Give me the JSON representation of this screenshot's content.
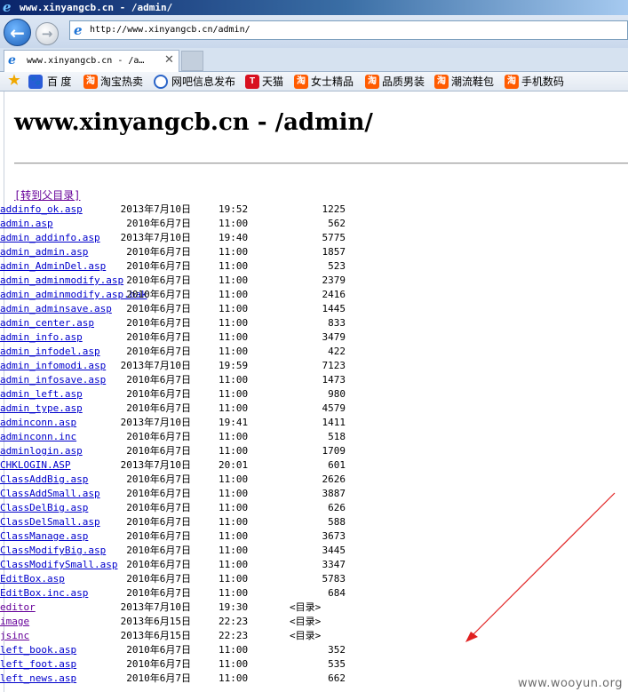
{
  "window": {
    "title": "www.xinyangcb.cn - /admin/"
  },
  "navigation": {
    "address": "http://www.xinyangcb.cn/admin/"
  },
  "tab": {
    "title": "www.xinyangcb.cn - /a…"
  },
  "favorites": [
    {
      "label": "百 度",
      "icon": "baidu-icon"
    },
    {
      "label": "淘宝热卖",
      "icon": "taobao-icon"
    },
    {
      "label": "网吧信息发布",
      "icon": "wangba-icon"
    },
    {
      "label": "天猫",
      "icon": "tmall-icon"
    },
    {
      "label": "女士精品",
      "icon": "taobao-icon"
    },
    {
      "label": "品质男装",
      "icon": "taobao-icon"
    },
    {
      "label": "潮流鞋包",
      "icon": "taobao-icon"
    },
    {
      "label": "手机数码",
      "icon": "taobao-icon"
    }
  ],
  "page": {
    "heading": "www.xinyangcb.cn - /admin/",
    "parent_link": "[转到父目录]",
    "dir_marker": "<目录>"
  },
  "entries": [
    {
      "date": "2013年7月10日",
      "time": "19:52",
      "size": "1225",
      "name": "addinfo_ok.asp"
    },
    {
      "date": "2010年6月7日",
      "time": "11:00",
      "size": "562",
      "name": "admin.asp"
    },
    {
      "date": "2013年7月10日",
      "time": "19:40",
      "size": "5775",
      "name": "admin_addinfo.asp"
    },
    {
      "date": "2010年6月7日",
      "time": "11:00",
      "size": "1857",
      "name": "admin_admin.asp"
    },
    {
      "date": "2010年6月7日",
      "time": "11:00",
      "size": "523",
      "name": "admin_AdminDel.asp"
    },
    {
      "date": "2010年6月7日",
      "time": "11:00",
      "size": "2379",
      "name": "admin_adminmodify.asp"
    },
    {
      "date": "2010年6月7日",
      "time": "11:00",
      "size": "2416",
      "name": "admin_adminmodify.asp.bak"
    },
    {
      "date": "2010年6月7日",
      "time": "11:00",
      "size": "1445",
      "name": "admin_adminsave.asp"
    },
    {
      "date": "2010年6月7日",
      "time": "11:00",
      "size": "833",
      "name": "admin_center.asp"
    },
    {
      "date": "2010年6月7日",
      "time": "11:00",
      "size": "3479",
      "name": "admin_info.asp"
    },
    {
      "date": "2010年6月7日",
      "time": "11:00",
      "size": "422",
      "name": "admin_infodel.asp"
    },
    {
      "date": "2013年7月10日",
      "time": "19:59",
      "size": "7123",
      "name": "admin_infomodi.asp"
    },
    {
      "date": "2010年6月7日",
      "time": "11:00",
      "size": "1473",
      "name": "admin_infosave.asp"
    },
    {
      "date": "2010年6月7日",
      "time": "11:00",
      "size": "980",
      "name": "admin_left.asp"
    },
    {
      "date": "2010年6月7日",
      "time": "11:00",
      "size": "4579",
      "name": "admin_type.asp"
    },
    {
      "date": "2013年7月10日",
      "time": "19:41",
      "size": "1411",
      "name": "adminconn.asp"
    },
    {
      "date": "2010年6月7日",
      "time": "11:00",
      "size": "518",
      "name": "adminconn.inc"
    },
    {
      "date": "2010年6月7日",
      "time": "11:00",
      "size": "1709",
      "name": "adminlogin.asp"
    },
    {
      "date": "2013年7月10日",
      "time": "20:01",
      "size": "601",
      "name": "CHKLOGIN.ASP"
    },
    {
      "date": "2010年6月7日",
      "time": "11:00",
      "size": "2626",
      "name": "ClassAddBig.asp"
    },
    {
      "date": "2010年6月7日",
      "time": "11:00",
      "size": "3887",
      "name": "ClassAddSmall.asp"
    },
    {
      "date": "2010年6月7日",
      "time": "11:00",
      "size": "626",
      "name": "ClassDelBig.asp"
    },
    {
      "date": "2010年6月7日",
      "time": "11:00",
      "size": "588",
      "name": "ClassDelSmall.asp"
    },
    {
      "date": "2010年6月7日",
      "time": "11:00",
      "size": "3673",
      "name": "ClassManage.asp"
    },
    {
      "date": "2010年6月7日",
      "time": "11:00",
      "size": "3445",
      "name": "ClassModifyBig.asp"
    },
    {
      "date": "2010年6月7日",
      "time": "11:00",
      "size": "3347",
      "name": "ClassModifySmall.asp"
    },
    {
      "date": "2010年6月7日",
      "time": "11:00",
      "size": "5783",
      "name": "EditBox.asp"
    },
    {
      "date": "2010年6月7日",
      "time": "11:00",
      "size": "684",
      "name": "EditBox.inc.asp"
    },
    {
      "date": "2013年7月10日",
      "time": "19:30",
      "dir": true,
      "name": "editor"
    },
    {
      "date": "2013年6月15日",
      "time": "22:23",
      "dir": true,
      "name": "image"
    },
    {
      "date": "2013年6月15日",
      "time": "22:23",
      "dir": true,
      "name": "jsinc"
    },
    {
      "date": "2010年6月7日",
      "time": "11:00",
      "size": "352",
      "name": "left_book.asp"
    },
    {
      "date": "2010年6月7日",
      "time": "11:00",
      "size": "535",
      "name": "left_foot.asp"
    },
    {
      "date": "2010年6月7日",
      "time": "11:00",
      "size": "662",
      "name": "left_news.asp"
    }
  ],
  "watermark": "www.wooyun.org",
  "colors": {
    "link": "#0000cc",
    "visited": "#660099",
    "annotation_arrow": "#e02020"
  }
}
